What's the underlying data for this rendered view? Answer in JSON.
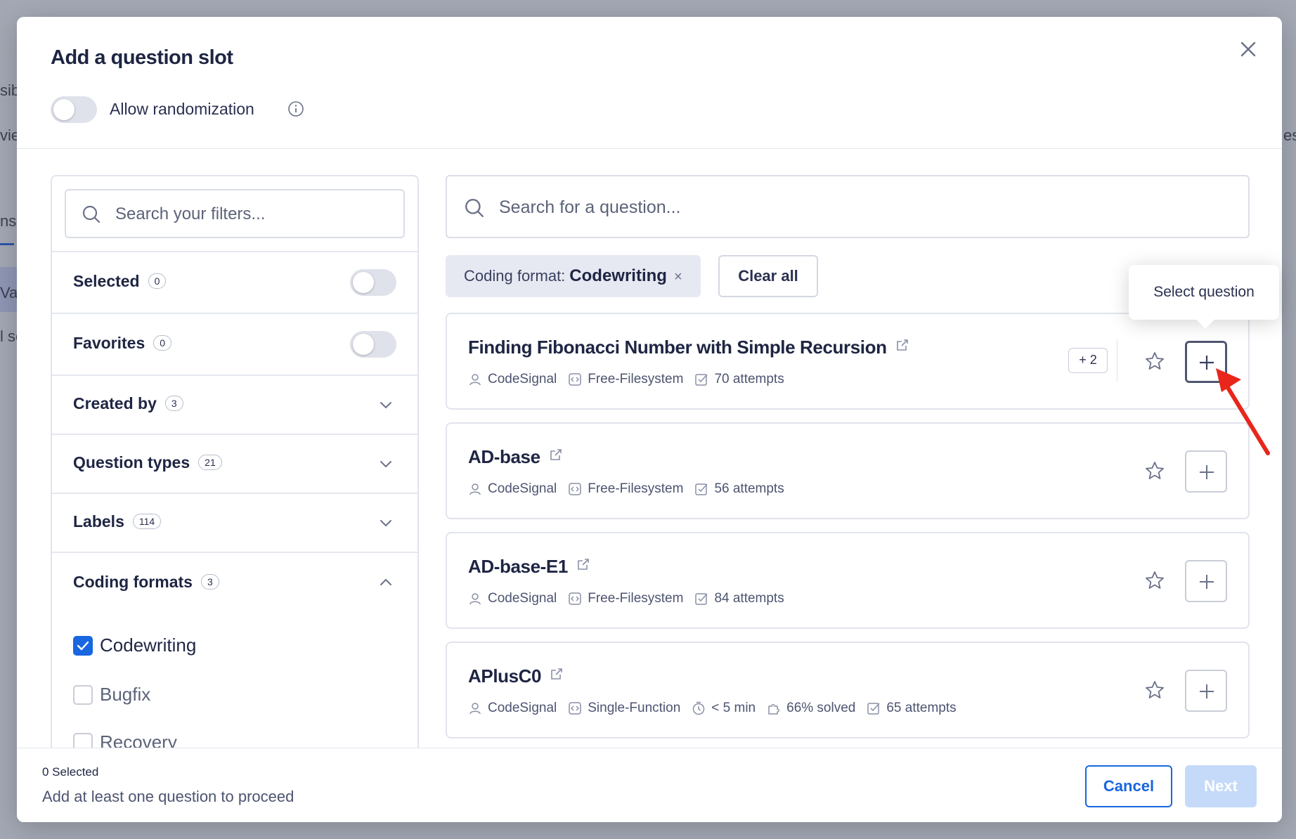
{
  "background": {
    "fragments": [
      "sib",
      "vie",
      "ns",
      "Va",
      "l se",
      "es"
    ]
  },
  "modal": {
    "title": "Add a question slot",
    "randomization_label": "Allow randomization"
  },
  "filters": {
    "search_placeholder": "Search your filters...",
    "rows": [
      {
        "label": "Selected",
        "count": "0",
        "kind": "toggle"
      },
      {
        "label": "Favorites",
        "count": "0",
        "kind": "toggle"
      },
      {
        "label": "Created by",
        "count": "3",
        "kind": "collapsed"
      },
      {
        "label": "Question types",
        "count": "21",
        "kind": "collapsed"
      },
      {
        "label": "Labels",
        "count": "114",
        "kind": "collapsed"
      },
      {
        "label": "Coding formats",
        "count": "3",
        "kind": "expanded"
      }
    ],
    "coding_formats": [
      {
        "label": "Codewriting",
        "checked": true
      },
      {
        "label": "Bugfix",
        "checked": false
      },
      {
        "label": "Recovery",
        "checked": false
      }
    ]
  },
  "search": {
    "placeholder": "Search for a question..."
  },
  "active_filter": {
    "key": "Coding format:",
    "value": "Codewriting",
    "remove": "×"
  },
  "clear_all": "Clear all",
  "tooltip": "Select question",
  "questions": [
    {
      "title": "Finding Fibonacci Number with Simple Recursion",
      "author": "CodeSignal",
      "format": "Free-Filesystem",
      "attempts": "70 attempts",
      "extra": "+ 2"
    },
    {
      "title": "AD-base",
      "author": "CodeSignal",
      "format": "Free-Filesystem",
      "attempts": "56 attempts"
    },
    {
      "title": "AD-base-E1",
      "author": "CodeSignal",
      "format": "Free-Filesystem",
      "attempts": "84 attempts"
    },
    {
      "title": "APlusC0",
      "author": "CodeSignal",
      "format": "Single-Function",
      "duration": "< 5 min",
      "solved": "66% solved",
      "attempts": "65 attempts"
    }
  ],
  "footer": {
    "selected_count": "0 Selected",
    "hint": "Add at least one question to proceed",
    "cancel": "Cancel",
    "next": "Next"
  },
  "colors": {
    "accent": "#1866e0",
    "next_disabled": "#c5daf9",
    "annotation_arrow": "#e8261b"
  }
}
